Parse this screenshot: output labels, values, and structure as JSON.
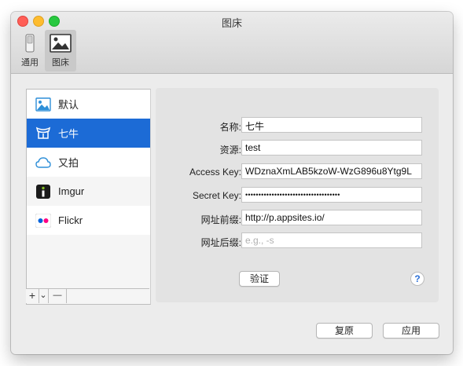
{
  "window": {
    "title": "图床"
  },
  "toolbar": {
    "items": [
      {
        "label": "通用",
        "icon": "switch-icon"
      },
      {
        "label": "图床",
        "icon": "picture-icon"
      }
    ]
  },
  "services": [
    {
      "label": "默认",
      "icon": "default-image-icon"
    },
    {
      "label": "七牛",
      "icon": "qiniu-icon",
      "selected": true
    },
    {
      "label": "又拍",
      "icon": "upyun-cloud-icon"
    },
    {
      "label": "Imgur",
      "icon": "imgur-icon"
    },
    {
      "label": "Flickr",
      "icon": "flickr-icon"
    }
  ],
  "sidebar_footer": {
    "add_label": "+",
    "dropdown_label": "⌄",
    "remove_label": "—"
  },
  "form": {
    "name_label": "名称:",
    "name_value": "七牛",
    "resource_label": "资源:",
    "resource_value": "test",
    "access_key_label": "Access Key:",
    "access_key_value": "WDznaXmLAB5kzoW-WzG896u8Ytg9L",
    "secret_key_label": "Secret Key:",
    "secret_key_value": "••••••••••••••••••••••••••••••••••••",
    "prefix_label": "网址前缀:",
    "prefix_value": "http://p.appsites.io/",
    "suffix_label": "网址后缀:",
    "suffix_placeholder": "e.g., -s"
  },
  "buttons": {
    "verify": "验证",
    "help": "?",
    "reset": "复原",
    "apply": "应用"
  },
  "colors": {
    "selection": "#1c6bd6",
    "accent": "#2a6fd6"
  }
}
